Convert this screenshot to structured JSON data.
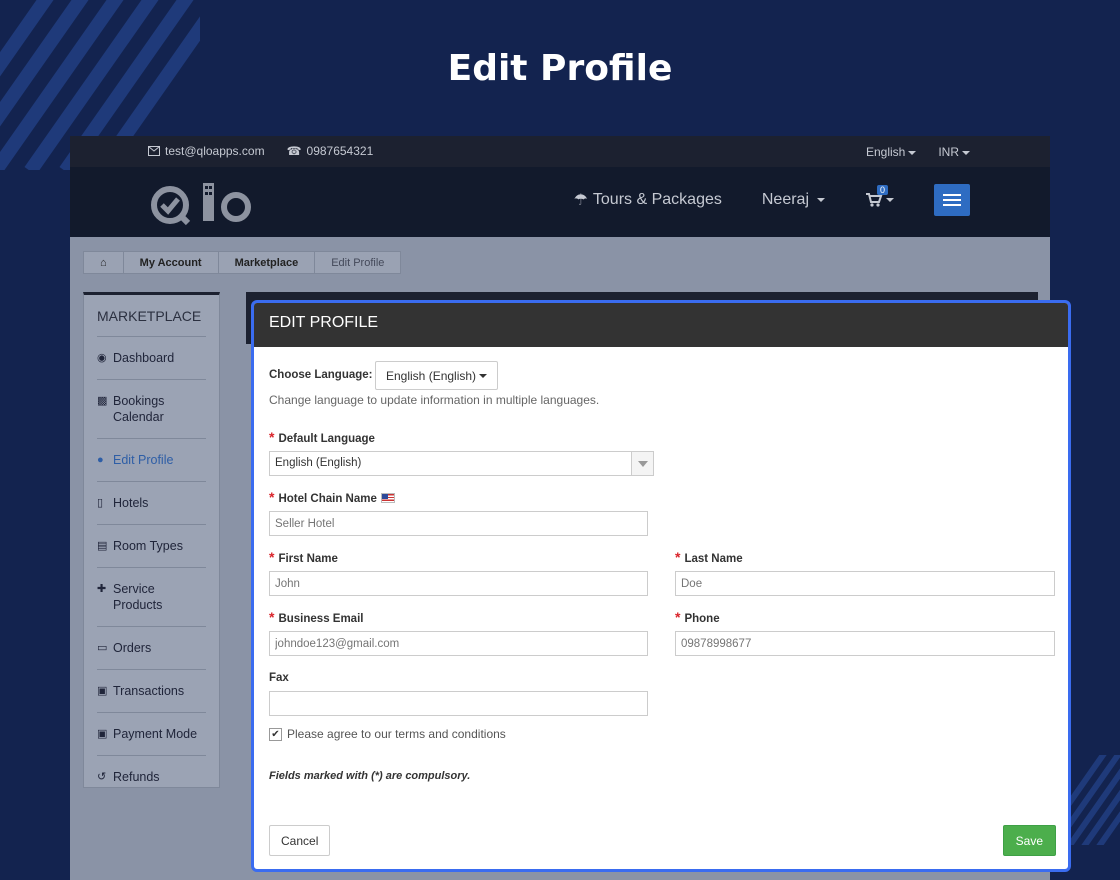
{
  "page": {
    "heading": "Edit Profile"
  },
  "topbar": {
    "email": "test@qloapps.com",
    "phone": "0987654321",
    "language": "English",
    "currency": "INR"
  },
  "navbar": {
    "logo_text": "Qlo",
    "tours_label": "Tours & Packages",
    "user_label": "Neeraj",
    "cart_count": "0"
  },
  "breadcrumb": {
    "items": [
      "My Account",
      "Marketplace",
      "Edit Profile"
    ]
  },
  "sidebar": {
    "title": "MARKETPLACE",
    "items": [
      {
        "label": "Dashboard",
        "icon": "dashboard-icon"
      },
      {
        "label": "Bookings Calendar",
        "icon": "bar-chart-icon"
      },
      {
        "label": "Edit Profile",
        "icon": "user-icon",
        "active": true
      },
      {
        "label": "Hotels",
        "icon": "building-icon"
      },
      {
        "label": "Room Types",
        "icon": "bed-icon"
      },
      {
        "label": "Service Products",
        "icon": "user-plus-icon"
      },
      {
        "label": "Orders",
        "icon": "credit-card-icon"
      },
      {
        "label": "Transactions",
        "icon": "money-icon"
      },
      {
        "label": "Payment Mode",
        "icon": "money-icon"
      },
      {
        "label": "Refunds",
        "icon": "undo-icon"
      }
    ]
  },
  "modal": {
    "title": "EDIT PROFILE",
    "choose_language_label": "Choose Language:",
    "choose_language_value": "English (English)",
    "choose_language_help": "Change language to update information in multiple languages.",
    "default_language_label": "Default Language",
    "default_language_value": "English (English)",
    "hotel_chain_label": "Hotel Chain Name",
    "hotel_chain_placeholder": "Seller Hotel",
    "first_name_label": "First Name",
    "first_name_placeholder": "John",
    "last_name_label": "Last Name",
    "last_name_placeholder": "Doe",
    "business_email_label": "Business Email",
    "business_email_placeholder": "johndoe123@gmail.com",
    "phone_label": "Phone",
    "phone_placeholder": "09878998677",
    "fax_label": "Fax",
    "fax_placeholder": "",
    "terms_label": "Please agree to our terms and conditions",
    "terms_checked": true,
    "compulsory_note": "Fields marked with (*) are compulsory.",
    "cancel_label": "Cancel",
    "save_label": "Save"
  },
  "colors": {
    "page_bg": "#13234f",
    "modal_border": "#3a6cf0",
    "required": "#d9242b",
    "save": "#4cae4c",
    "accent": "#2e6cc2"
  }
}
